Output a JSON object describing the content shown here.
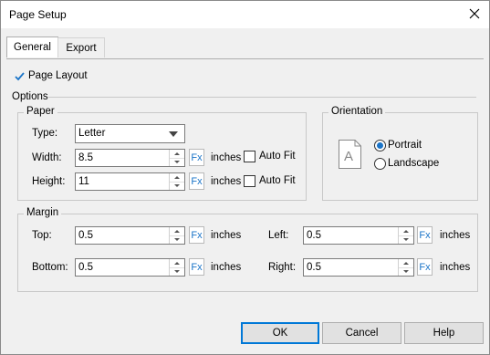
{
  "window": {
    "title": "Page Setup"
  },
  "tabs": [
    {
      "label": "General"
    },
    {
      "label": "Export"
    }
  ],
  "page_layout": {
    "label": "Page Layout",
    "checked": true
  },
  "options": {
    "label": "Options"
  },
  "paper": {
    "label": "Paper",
    "type_label": "Type:",
    "type_value": "Letter",
    "width_label": "Width:",
    "width_value": "8.5",
    "height_label": "Height:",
    "height_value": "11",
    "unit": "inches",
    "autofit_label": "Auto Fit"
  },
  "orientation": {
    "label": "Orientation",
    "portrait": "Portrait",
    "landscape": "Landscape",
    "selected": "Portrait",
    "icon_letter": "A"
  },
  "margin": {
    "label": "Margin",
    "top_label": "Top:",
    "top_value": "0.5",
    "bottom_label": "Bottom:",
    "bottom_value": "0.5",
    "left_label": "Left:",
    "left_value": "0.5",
    "right_label": "Right:",
    "right_value": "0.5",
    "unit": "inches"
  },
  "fx_label": "Fx",
  "buttons": {
    "ok": "OK",
    "cancel": "Cancel",
    "help": "Help"
  },
  "colors": {
    "accent": "#0078d7",
    "fx": "#1a74c8"
  }
}
